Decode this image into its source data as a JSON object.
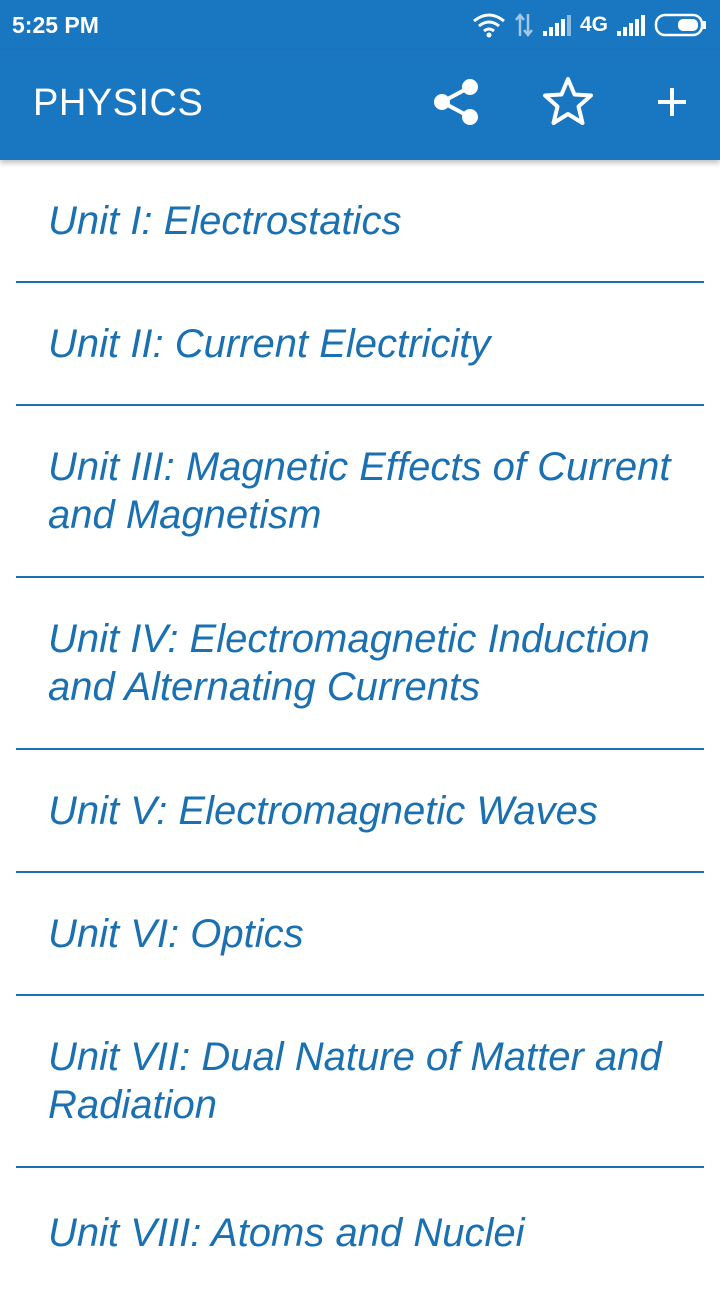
{
  "status_bar": {
    "time": "5:25 PM",
    "network_type": "4G",
    "icons": [
      "wifi-icon",
      "data-transfer-icon",
      "signal-icon",
      "signal-icon",
      "battery-icon"
    ]
  },
  "app_bar": {
    "title": "PHYSICS",
    "actions": [
      "share-icon",
      "star-icon",
      "add-icon"
    ]
  },
  "colors": {
    "primary": "#1976c0",
    "text_accent": "#1a70b0",
    "background": "#ffffff"
  },
  "units": [
    {
      "label": "Unit I: Electrostatics"
    },
    {
      "label": "Unit II: Current Electricity"
    },
    {
      "label": "Unit III: Magnetic Effects of Current and Magnetism"
    },
    {
      "label": "Unit IV: Electromagnetic Induction and Alternating Currents"
    },
    {
      "label": "Unit V: Electromagnetic Waves"
    },
    {
      "label": "Unit VI: Optics"
    },
    {
      "label": "Unit VII: Dual Nature of Matter and Radiation"
    },
    {
      "label": "Unit VIII: Atoms and Nuclei"
    }
  ]
}
